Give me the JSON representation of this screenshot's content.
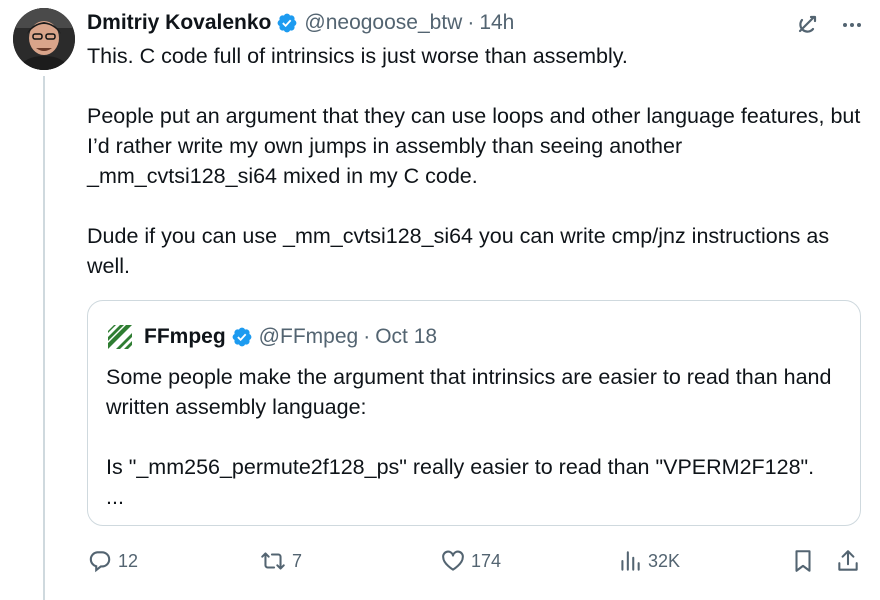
{
  "author": {
    "name": "Dmitriy Kovalenko",
    "handle": "@neogoose_btw",
    "separator": "·",
    "time": "14h"
  },
  "tweet": {
    "paragraphs": [
      "This. C code full of intrinsics is just worse than assembly.",
      "People put an argument that they can use loops and other language features, but I’d rather write my own jumps in assembly than seeing another _mm_cvtsi128_si64 mixed in my C code.",
      "Dude if you can use _mm_cvtsi128_si64 you can write cmp/jnz instructions as well."
    ]
  },
  "quote": {
    "name": "FFmpeg",
    "handle": "@FFmpeg",
    "separator": "·",
    "time": "Oct 18",
    "paragraphs": [
      "Some people make the argument that intrinsics are easier to read than hand written assembly language:",
      "Is \"_mm256_permute2f128_ps\" really  easier to read than \"VPERM2F128\".",
      "..."
    ]
  },
  "actions": {
    "replies": "12",
    "reposts": "7",
    "likes": "174",
    "views": "32K"
  },
  "icons": {
    "verified": "verified-badge-icon",
    "grok": "grok-icon",
    "more": "more-icon",
    "reply": "reply-icon",
    "repost": "repost-icon",
    "like": "like-icon",
    "views": "views-icon",
    "bookmark": "bookmark-icon",
    "share": "share-icon",
    "ffmpeg_logo": "ffmpeg-logo-icon"
  },
  "colors": {
    "verified": "#1d9bf0",
    "text": "#0f1419",
    "secondary": "#536471",
    "border": "#cfd9de",
    "ffmpeg_green": "#2f7d32"
  }
}
